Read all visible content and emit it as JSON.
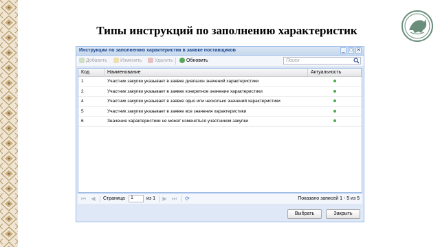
{
  "slide": {
    "title": "Типы инструкций по заполнению характеристик"
  },
  "window": {
    "title": "Инструкции по заполнению характеристик в заявке поставщиков",
    "tools": [
      "_",
      "□",
      "✕"
    ]
  },
  "toolbar": {
    "add_label": "Добавить",
    "edit_label": "Изменить",
    "delete_label": "Удалить",
    "refresh_label": "Обновить",
    "search_placeholder": "Поиск"
  },
  "grid": {
    "columns": [
      "Код",
      "Наименование",
      "Актуальность"
    ],
    "rows": [
      {
        "code": "1",
        "name": "Участник закупки указывает в заявке диапазон значений характеристики",
        "active": true
      },
      {
        "code": "2",
        "name": "Участник закупки указывает в заявке конкретное значение характеристики",
        "active": true
      },
      {
        "code": "4",
        "name": "Участник закупки указывает в заявке одно или несколько значений характеристики",
        "active": true
      },
      {
        "code": "5",
        "name": "Участник закупки указывает в заявке все значения характеристики",
        "active": true
      },
      {
        "code": "6",
        "name": "Значение характеристики не может изменяться участником закупки",
        "active": true
      }
    ]
  },
  "pager": {
    "page_label": "Страница",
    "page_value": "1",
    "of_label": "из 1",
    "summary": "Показано записей 1 - 5 из 5"
  },
  "footer": {
    "select_label": "Выбрать",
    "close_label": "Закрыть"
  },
  "colors": {
    "window_border": "#99bbe8",
    "window_bg": "#dfe8f6",
    "active_dot": "#4aa84a",
    "logo": "#6b8e7a"
  }
}
